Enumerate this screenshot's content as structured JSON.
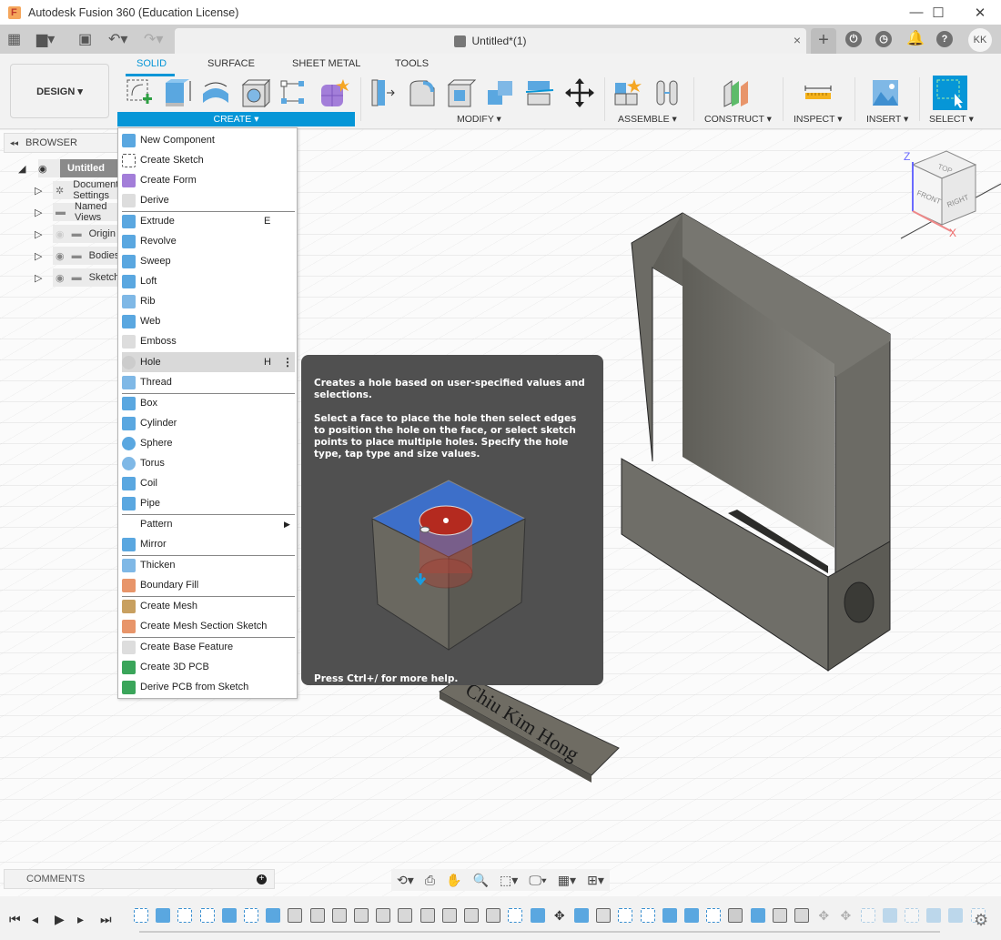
{
  "window": {
    "title": "Autodesk Fusion 360 (Education License)",
    "controls": [
      "minimize",
      "maximize",
      "close"
    ]
  },
  "tabbar": {
    "document_tab": "Untitled*(1)",
    "close_symbol": "×",
    "new_tab_symbol": "+",
    "user_initials": "KK",
    "left_icons": [
      "apps-grid-icon",
      "file-icon",
      "save-icon",
      "undo-icon",
      "redo-icon"
    ],
    "right_icons": [
      "extensions-icon",
      "job-status-icon",
      "notifications-icon",
      "help-icon"
    ]
  },
  "ribbon": {
    "workspace": "DESIGN ▾",
    "tabs": [
      {
        "label": "SOLID",
        "active": true
      },
      {
        "label": "SURFACE",
        "active": false
      },
      {
        "label": "SHEET METAL",
        "active": false
      },
      {
        "label": "TOOLS",
        "active": false
      }
    ],
    "groups": [
      {
        "label": "CREATE ▾",
        "icons": [
          "create-sketch-icon",
          "extrude-icon",
          "revolve-icon",
          "hole-icon",
          "pattern-icon",
          "create-form-icon"
        ]
      },
      {
        "label": "MODIFY ▾",
        "icons": [
          "press-pull-icon",
          "fillet-icon",
          "shell-icon",
          "combine-icon",
          "split-body-icon",
          "move-icon"
        ]
      },
      {
        "label": "ASSEMBLE ▾",
        "icons": [
          "new-component-icon",
          "joint-icon"
        ]
      },
      {
        "label": "CONSTRUCT ▾",
        "icons": [
          "offset-plane-icon"
        ]
      },
      {
        "label": "INSPECT ▾",
        "icons": [
          "measure-icon"
        ]
      },
      {
        "label": "INSERT ▾",
        "icons": [
          "insert-image-icon"
        ]
      },
      {
        "label": "SELECT ▾",
        "icons": [
          "select-icon"
        ]
      }
    ]
  },
  "browser": {
    "header": "BROWSER",
    "items": [
      {
        "label": "Untitled",
        "level": 0,
        "expanded": true
      },
      {
        "label": "Document Settings",
        "level": 1
      },
      {
        "label": "Named Views",
        "level": 1
      },
      {
        "label": "Origin",
        "level": 1,
        "hidden": true
      },
      {
        "label": "Bodies",
        "level": 1
      },
      {
        "label": "Sketches",
        "level": 1
      }
    ]
  },
  "create_menu": {
    "items": [
      {
        "label": "New Component",
        "icon": "new-component-icon"
      },
      {
        "label": "Create Sketch",
        "icon": "create-sketch-icon"
      },
      {
        "label": "Create Form",
        "icon": "create-form-icon"
      },
      {
        "label": "Derive",
        "icon": "derive-icon"
      },
      {
        "separator": true
      },
      {
        "label": "Extrude",
        "icon": "extrude-icon",
        "shortcut": "E"
      },
      {
        "label": "Revolve",
        "icon": "revolve-icon"
      },
      {
        "label": "Sweep",
        "icon": "sweep-icon"
      },
      {
        "label": "Loft",
        "icon": "loft-icon"
      },
      {
        "label": "Rib",
        "icon": "rib-icon"
      },
      {
        "label": "Web",
        "icon": "web-icon"
      },
      {
        "label": "Emboss",
        "icon": "emboss-icon"
      },
      {
        "separator": true
      },
      {
        "label": "Hole",
        "icon": "hole-icon",
        "shortcut": "H",
        "highlighted": true,
        "more": "⋮"
      },
      {
        "label": "Thread",
        "icon": "thread-icon"
      },
      {
        "separator": true
      },
      {
        "label": "Box",
        "icon": "box-icon"
      },
      {
        "label": "Cylinder",
        "icon": "cylinder-icon"
      },
      {
        "label": "Sphere",
        "icon": "sphere-icon"
      },
      {
        "label": "Torus",
        "icon": "torus-icon"
      },
      {
        "label": "Coil",
        "icon": "coil-icon"
      },
      {
        "label": "Pipe",
        "icon": "pipe-icon"
      },
      {
        "separator": true
      },
      {
        "label": "Pattern",
        "icon": "",
        "submenu": "▶"
      },
      {
        "label": "Mirror",
        "icon": "mirror-icon"
      },
      {
        "separator": true
      },
      {
        "label": "Thicken",
        "icon": "thicken-icon"
      },
      {
        "label": "Boundary Fill",
        "icon": "boundary-fill-icon"
      },
      {
        "separator": true
      },
      {
        "label": "Create Mesh",
        "icon": "create-mesh-icon"
      },
      {
        "label": "Create Mesh Section Sketch",
        "icon": "mesh-section-sketch-icon"
      },
      {
        "separator": true
      },
      {
        "label": "Create Base Feature",
        "icon": "base-feature-icon"
      },
      {
        "label": "Create 3D PCB",
        "icon": "pcb-3d-icon"
      },
      {
        "label": "Derive PCB from Sketch",
        "icon": "derive-pcb-icon"
      }
    ]
  },
  "tooltip": {
    "summary": "Creates a hole based on user-specified values and selections.",
    "details": "Select a face to place the hole then select edges to position the hole on the face, or select sketch points to place multiple holes. Specify the hole type, tap type and size values.",
    "footer": "Press Ctrl+/ for more help."
  },
  "viewcube": {
    "top": "TOP",
    "front": "FRONT",
    "right": "RIGHT",
    "axis_z": "Z",
    "axis_x": "X"
  },
  "model": {
    "nameplate_text": "Chiu Kim Hong"
  },
  "comments": {
    "label": "COMMENTS",
    "add_symbol": "+"
  },
  "nav_toolbar": {
    "icons": [
      "orbit-icon",
      "look-at-icon",
      "pan-icon",
      "zoom-icon",
      "fit-icon",
      "display-settings-icon",
      "grid-snaps-icon",
      "viewports-icon"
    ]
  },
  "timeline": {
    "controls": [
      "first",
      "previous",
      "play",
      "next",
      "last"
    ],
    "features": [
      "sketch",
      "extrude",
      "sketch",
      "sketch",
      "extrude",
      "sketch",
      "extrude",
      "fillet",
      "fillet",
      "fillet",
      "fillet",
      "fillet",
      "fillet",
      "fillet",
      "fillet",
      "fillet",
      "chamfer",
      "sketch",
      "extrude",
      "move",
      "box",
      "shell",
      "sketch",
      "sketch",
      "extrude",
      "extrude",
      "sketch",
      "hole",
      "extrude",
      "fillet",
      "fillet",
      "move",
      "move",
      "sketch",
      "extrude",
      "sketch",
      "extrude",
      "extrude",
      "sketch"
    ],
    "suppressed_from_index": 31
  },
  "colors": {
    "accent": "#0696d7",
    "tooltip_bg": "#505050",
    "menu_highlight": "#d9d9d9"
  }
}
